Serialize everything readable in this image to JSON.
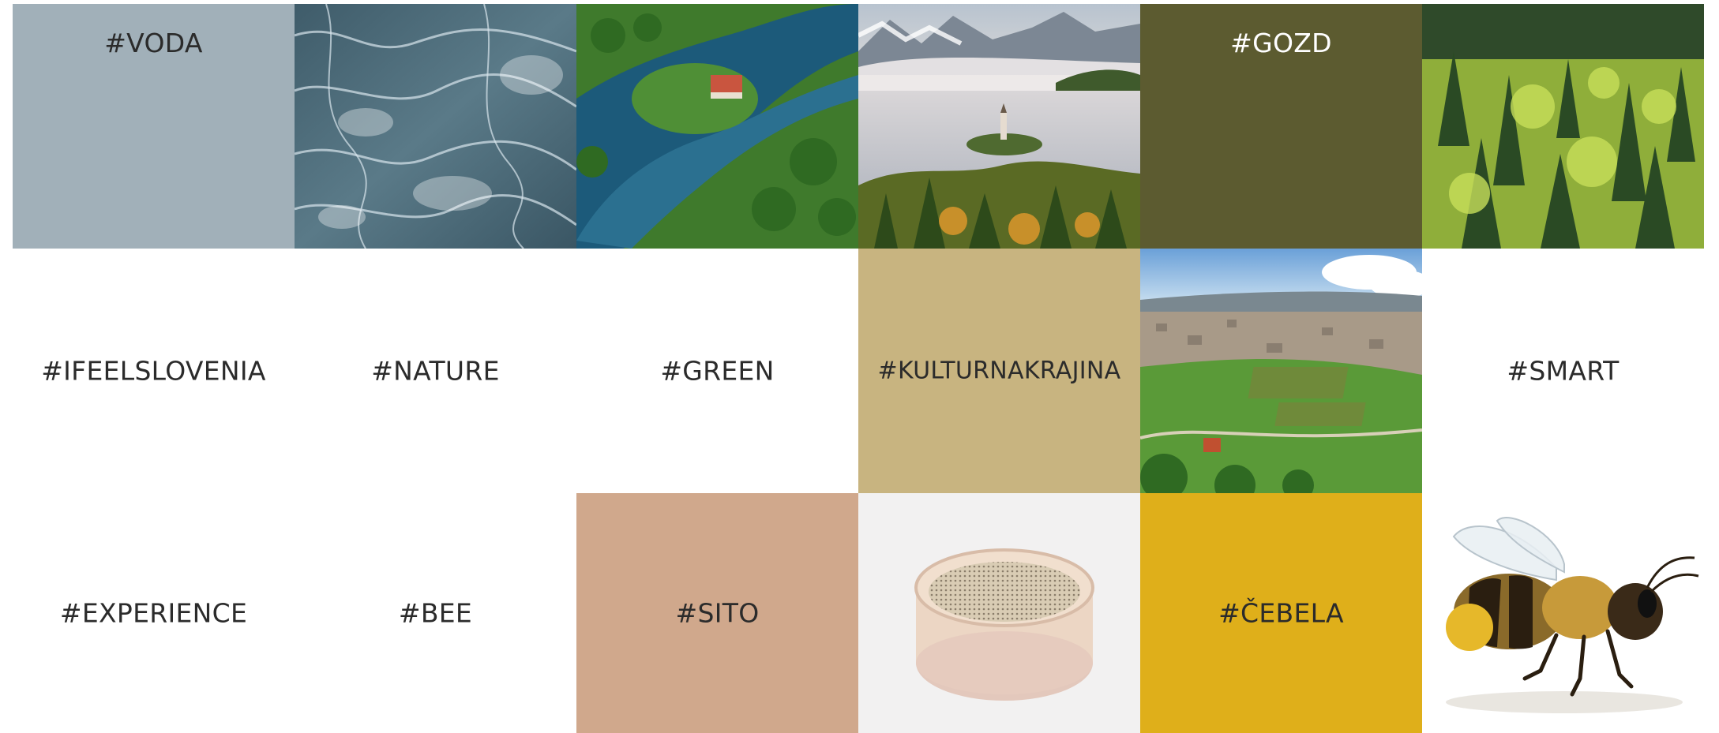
{
  "tiles": {
    "voda": {
      "label": "#VODA",
      "color": "#a1b0b9"
    },
    "gozd": {
      "label": "#GOZD",
      "color": "#5c5b30"
    },
    "ifeelslovenia": {
      "label": "#IFEELSLOVENIA"
    },
    "nature": {
      "label": "#NATURE"
    },
    "green": {
      "label": "#GREEN"
    },
    "kulturnakrajina": {
      "label": "#KULTURNAKRAJINA",
      "color": "#c8b480"
    },
    "smart": {
      "label": "#SMART"
    },
    "experience": {
      "label": "#EXPERIENCE"
    },
    "bee": {
      "label": "#BEE"
    },
    "sito": {
      "label": "#SITO",
      "color": "#d0a88c"
    },
    "cebela": {
      "label": "#ČEBELA",
      "color": "#dfaf1a"
    }
  },
  "images": {
    "water": "water-photo",
    "river_castle": "river-castle-aerial-photo",
    "lake_bled": "lake-bled-photo",
    "forest": "forest-photo",
    "town": "town-aerial-photo",
    "sieve": "sieve-photo",
    "bee": "bee-photo"
  }
}
